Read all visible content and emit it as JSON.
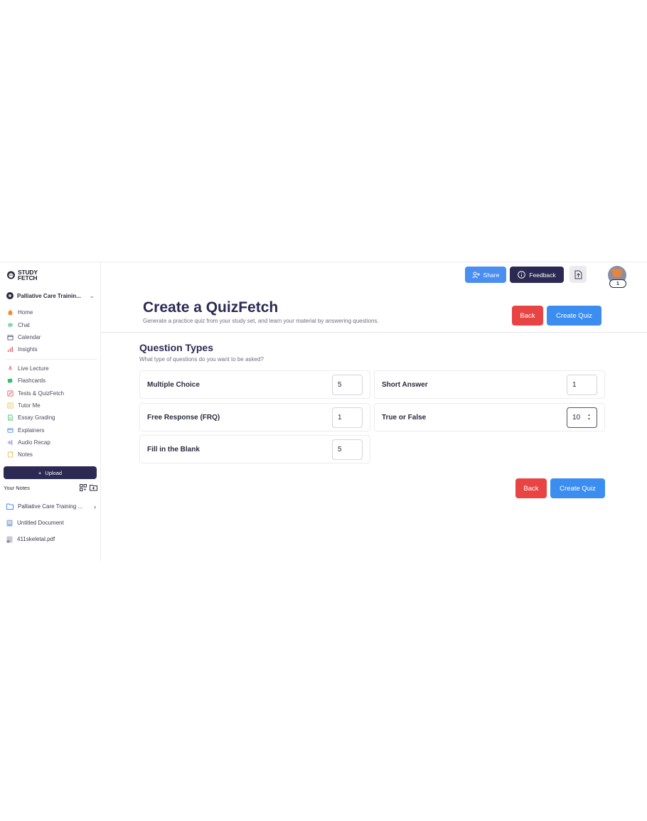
{
  "logo": {
    "line1": "STUDY",
    "line2": "FETCH"
  },
  "study_set": {
    "name": "Palliative Care Trainin..."
  },
  "nav": {
    "primary": [
      {
        "label": "Home",
        "icon": "home-icon",
        "color": "#f08c2a"
      },
      {
        "label": "Chat",
        "icon": "chat-icon",
        "color": "#8fd0b0"
      },
      {
        "label": "Calendar",
        "icon": "calendar-icon",
        "color": "#555566"
      },
      {
        "label": "Insights",
        "icon": "insights-icon",
        "color": "#e05a5a"
      }
    ],
    "tools": [
      {
        "label": "Live Lecture",
        "icon": "mic-icon",
        "color": "#e58aa0"
      },
      {
        "label": "Flashcards",
        "icon": "flashcards-icon",
        "color": "#3cba6c"
      },
      {
        "label": "Tests & QuizFetch",
        "icon": "pencil-icon",
        "color": "#e05a5a"
      },
      {
        "label": "Tutor Me",
        "icon": "tutor-icon",
        "color": "#e6c04a"
      },
      {
        "label": "Essay Grading",
        "icon": "essay-icon",
        "color": "#3cba6c"
      },
      {
        "label": "Explainers",
        "icon": "explainers-icon",
        "color": "#4a8ff0"
      },
      {
        "label": "Audio Recap",
        "icon": "audio-icon",
        "color": "#7a6fd6"
      },
      {
        "label": "Notes",
        "icon": "notes-icon",
        "color": "#e6c04a"
      }
    ]
  },
  "upload": {
    "label": "Upload"
  },
  "your_notes": {
    "label": "Your Notes",
    "items": [
      {
        "label": "Palliative Care Training ...",
        "icon": "folder-icon"
      },
      {
        "label": "Untitled Document",
        "icon": "document-icon"
      },
      {
        "label": "411skeletal.pdf",
        "icon": "pdf-icon"
      }
    ]
  },
  "topbar": {
    "share": "Share",
    "feedback": "Feedback",
    "badge": "1"
  },
  "header": {
    "title": "Create a QuizFetch",
    "subtitle": "Generate a practice quiz from your study set, and learn your material by answering questions.",
    "back": "Back",
    "create": "Create Quiz"
  },
  "question_types": {
    "title": "Question Types",
    "subtitle": "What type of questions do you want to be asked?",
    "items": [
      {
        "label": "Multiple Choice",
        "value": "5"
      },
      {
        "label": "Short Answer",
        "value": "1"
      },
      {
        "label": "Free Response (FRQ)",
        "value": "1"
      },
      {
        "label": "True or False",
        "value": "10"
      },
      {
        "label": "Fill in the Blank",
        "value": "5"
      }
    ]
  },
  "footer": {
    "back": "Back",
    "create": "Create Quiz"
  }
}
